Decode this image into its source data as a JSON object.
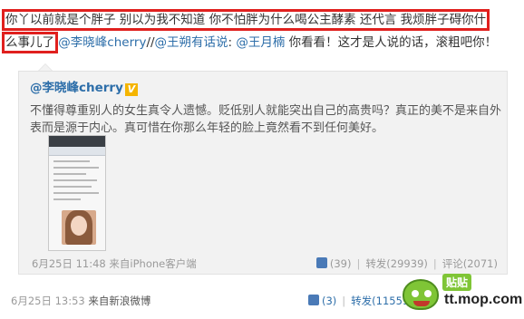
{
  "post": {
    "text_line1": "你丫以前就是个胖子 别以为我不知道 你不怕胖为什么喝公主酵素 还代言 我烦胖子碍你什",
    "text_line2_highlight": "么事儿了",
    "mention_1": "@李晓峰cherry",
    "sep_1": "//",
    "mention_2": "@王朔有话说",
    "sep_2": ": ",
    "mention_3": "@王月楠",
    "text_tail": " 你看看！这才是人说的话，滚粗吧你！"
  },
  "quote": {
    "author": "@李晓峰cherry",
    "badge": "V",
    "text": "不懂得尊重别人的女生真令人遗憾。贬低别人就能突出自己的高贵吗？真正的美不是来自外表而是源于内心。真可惜在你那么年轻的脸上竟然看不到任何美好。",
    "time": "6月25日 11:48",
    "source_prefix": "来自",
    "source": "iPhone客户端",
    "likes": "(39)",
    "reposts": "转发(29939)",
    "comments": "评论(2071)"
  },
  "footer": {
    "time": "6月25日 13:53",
    "source_prefix": "来自",
    "source": "新浪微博",
    "likes": "(3)",
    "reposts": "转发(11559)"
  },
  "watermark": {
    "badge": "贴贴",
    "site": "tt.mop.com"
  },
  "colors": {
    "link": "#2d6ea9",
    "highlight_border": "#e0201e",
    "quote_bg": "#f2f2f2",
    "watermark_green": "#7fc536"
  }
}
